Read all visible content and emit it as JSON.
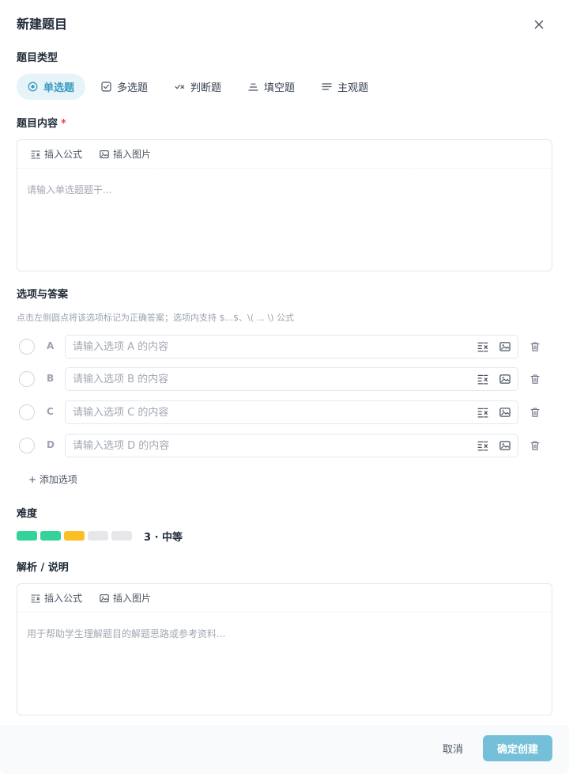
{
  "modal": {
    "title": "新建题目"
  },
  "question_type": {
    "label": "题目类型",
    "options": [
      {
        "label": "单选题",
        "icon": "radio-icon",
        "active": true
      },
      {
        "label": "多选题",
        "icon": "checkbox-icon",
        "active": false
      },
      {
        "label": "判断题",
        "icon": "check-cross-icon",
        "active": false
      },
      {
        "label": "填空题",
        "icon": "blank-icon",
        "active": false
      },
      {
        "label": "主观题",
        "icon": "lines-icon",
        "active": false
      }
    ]
  },
  "content": {
    "label": "题目内容",
    "required_mark": "*",
    "tools": {
      "formula": "插入公式",
      "image": "插入图片"
    },
    "placeholder": "请输入单选题题干..."
  },
  "options_section": {
    "label": "选项与答案",
    "hint": "点击左侧圆点将该选项标记为正确答案；选项内支持 $...$、\\( ... \\) 公式",
    "options": [
      {
        "letter": "A",
        "placeholder": "请输入选项 A 的内容",
        "value": ""
      },
      {
        "letter": "B",
        "placeholder": "请输入选项 B 的内容",
        "value": ""
      },
      {
        "letter": "C",
        "placeholder": "请输入选项 C 的内容",
        "value": ""
      },
      {
        "letter": "D",
        "placeholder": "请输入选项 D 的内容",
        "value": ""
      }
    ],
    "add_label": "+ 添加选项"
  },
  "difficulty": {
    "label": "难度",
    "level": 3,
    "max": 5,
    "text": "3 · 中等",
    "colors": [
      "#34d399",
      "#34d399",
      "#fbbf24",
      "#e5e7eb",
      "#e5e7eb"
    ]
  },
  "analysis": {
    "label": "解析 / 说明",
    "tools": {
      "formula": "插入公式",
      "image": "插入图片"
    },
    "placeholder": "用于帮助学生理解题目的解题思路或参考资料..."
  },
  "footer": {
    "cancel_label": "取消",
    "confirm_label": "确定创建"
  },
  "colors": {
    "accent": "#3a9bc0",
    "accent_bg": "#e6f3f8",
    "confirm_bg": "#75c0d8",
    "required": "#ef4444"
  }
}
